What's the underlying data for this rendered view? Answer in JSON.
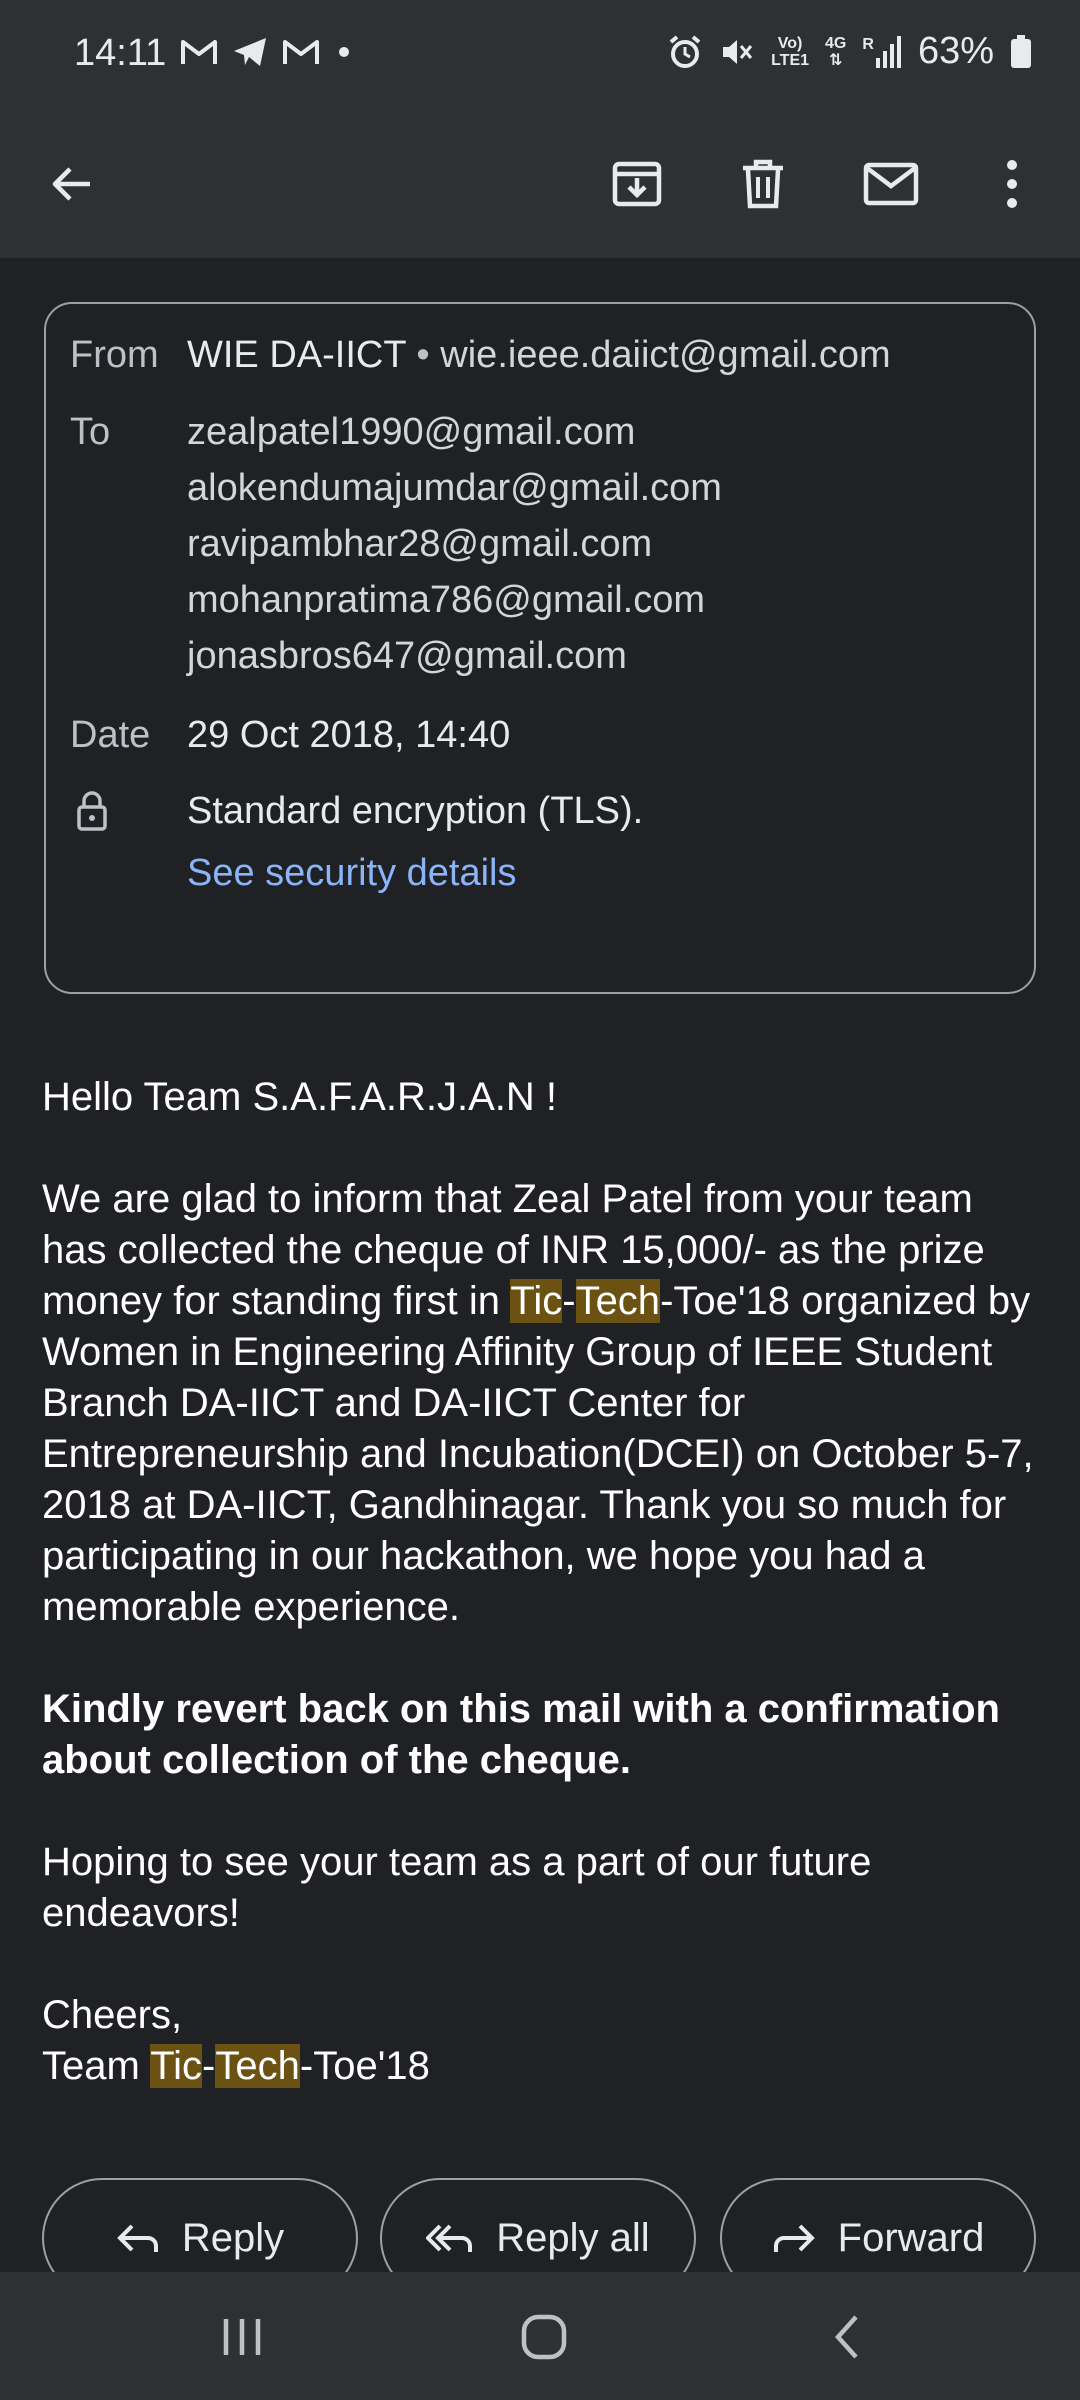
{
  "status_bar": {
    "time": "14:11",
    "left_icons": [
      "gmail-icon",
      "telegram-icon",
      "gmail-icon",
      "dot-icon"
    ],
    "volte_top": "Vo)",
    "volte_bottom": "LTE1",
    "network": "4G",
    "roaming": "R",
    "battery": "63%"
  },
  "toolbar": {
    "back": "back-arrow-icon",
    "archive": "archive-icon",
    "delete": "delete-icon",
    "mark_unread": "mail-icon",
    "more": "more-vert-icon"
  },
  "details": {
    "from_label": "From",
    "from_name": "WIE DA-IICT",
    "from_separator": "•",
    "from_email": "wie.ieee.daiict@gmail.com",
    "to_label": "To",
    "recipients": [
      "zealpatel1990@gmail.com",
      "alokendumajumdar@gmail.com",
      "ravipambhar28@gmail.com",
      "mohanpratima786@gmail.com",
      "jonasbros647@gmail.com"
    ],
    "date_label": "Date",
    "date_value": "29 Oct 2018, 14:40",
    "encryption": "Standard encryption (TLS).",
    "security_link": "See security details"
  },
  "body": {
    "greeting": "Hello Team S.A.F.A.R.J.A.N !",
    "para1_a": "We are glad to inform that Zeal Patel from your team has collected the cheque of INR 15,000/- as the prize money for standing first in ",
    "hl_tic": "Tic",
    "dash": "-",
    "hl_tech": "Tech",
    "para1_b": "-Toe'18 organized by Women in Engineering Affinity Group of IEEE Student Branch DA-IICT and  DA-IICT Center for Entrepreneurship and Incubation(DCEI) on October 5-7, 2018 at DA-IICT, Gandhinagar. Thank you so much for participating in our hackathon, we hope you had a memorable experience.",
    "bold_line": "Kindly revert back on this mail with a confirmation about collection of the cheque.",
    "hoping": "Hoping to see your team as a part of our future endeavors!",
    "cheers": "Cheers,",
    "sign_prefix": "Team ",
    "sign_suffix": "-Toe'18"
  },
  "actions": {
    "reply": "Reply",
    "reply_all": "Reply all",
    "forward": "Forward"
  },
  "nav": {
    "recents": "recents-icon",
    "home": "home-icon",
    "back": "nav-back-icon"
  },
  "colors": {
    "background": "#202124",
    "bars": "#2f3033",
    "link": "#8ab4f8",
    "highlight": "#6b5213"
  }
}
